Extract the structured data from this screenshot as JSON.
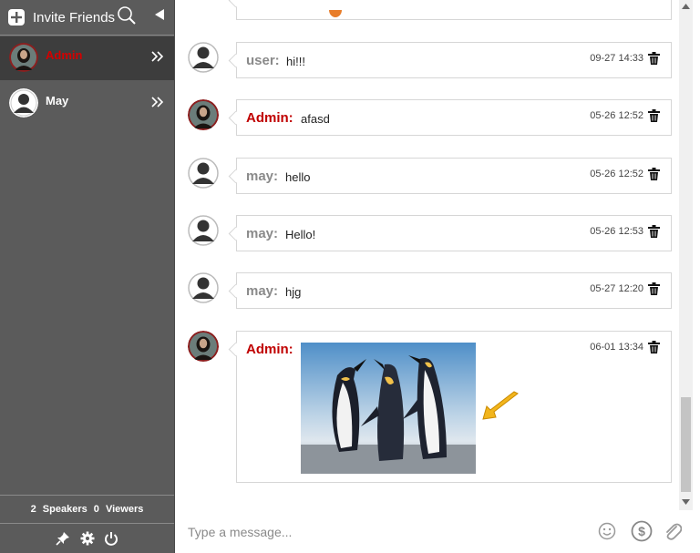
{
  "sidebar": {
    "invite_label": "Invite Friends",
    "users": [
      {
        "name": "Admin",
        "role": "admin"
      },
      {
        "name": "May",
        "role": "user"
      }
    ],
    "stats": {
      "speakers_count": "2",
      "speakers_label": "Speakers",
      "viewers_count": "0",
      "viewers_label": "Viewers"
    }
  },
  "messages": [
    {
      "sender": "user:",
      "role": "user",
      "text": "hi!!!",
      "time": "09-27 14:33"
    },
    {
      "sender": "Admin:",
      "role": "admin",
      "text": "afasd",
      "time": "05-26 12:52"
    },
    {
      "sender": "may:",
      "role": "user",
      "text": "hello",
      "time": "05-26 12:52"
    },
    {
      "sender": "may:",
      "role": "user",
      "text": "Hello!",
      "time": "05-26 12:53"
    },
    {
      "sender": "may:",
      "role": "user",
      "text": "hjg",
      "time": "05-27 12:20"
    },
    {
      "sender": "Admin:",
      "role": "admin",
      "text": "",
      "time": "06-01 13:34",
      "image": "penguins-photo"
    }
  ],
  "composer": {
    "placeholder": "Type a message..."
  },
  "colors": {
    "sidebar_bg": "#5b5b5b",
    "admin_name": "#c00000",
    "active_item": "#3d3d3d"
  }
}
